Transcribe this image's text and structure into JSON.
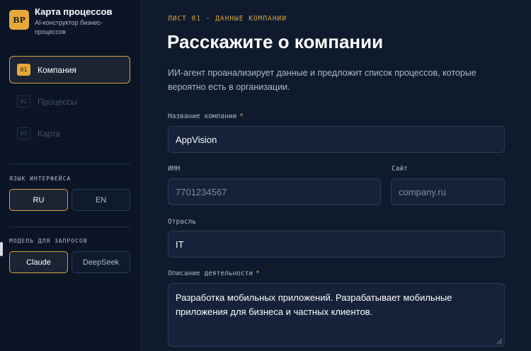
{
  "brand": {
    "logo": "BP",
    "title": "Карта процессов",
    "subtitle": "AI-конструктор бизнес-процессов"
  },
  "nav": {
    "items": [
      {
        "num": "01",
        "label": "Компания",
        "active": true
      },
      {
        "num": "02",
        "label": "Процессы",
        "active": false
      },
      {
        "num": "03",
        "label": "Карта",
        "active": false
      }
    ]
  },
  "language": {
    "label": "ЯЗЫК ИНТЕРФЕЙСА",
    "options": [
      "RU",
      "EN"
    ],
    "selected": "RU"
  },
  "model": {
    "label": "МОДЕЛЬ ДЛЯ ЗАПРОСОВ",
    "options": [
      "Claude",
      "DeepSeek"
    ],
    "selected": "Claude"
  },
  "main": {
    "eyebrow": "ЛИСТ 01 · ДАННЫЕ КОМПАНИИ",
    "title": "Расскажите о компании",
    "description": "ИИ-агент проанализирует данные и предложит список процессов, которые вероятно есть в организации."
  },
  "form": {
    "company_name": {
      "label": "Название компании",
      "required": "*",
      "value": "AppVision"
    },
    "inn": {
      "label": "ИНН",
      "placeholder": "7701234567"
    },
    "site": {
      "label": "Сайт",
      "placeholder": "company.ru"
    },
    "industry": {
      "label": "Отрасль",
      "value": "IT"
    },
    "activity": {
      "label": "Описание деятельности",
      "required": "*",
      "value": "Разработка мобильных приложений. Разрабатывает мобильные приложения для бизнеса и частных клиентов."
    }
  },
  "colors": {
    "accent": "#e7a83a",
    "background": "#0f1b2d",
    "sidebar": "#0b1526"
  }
}
